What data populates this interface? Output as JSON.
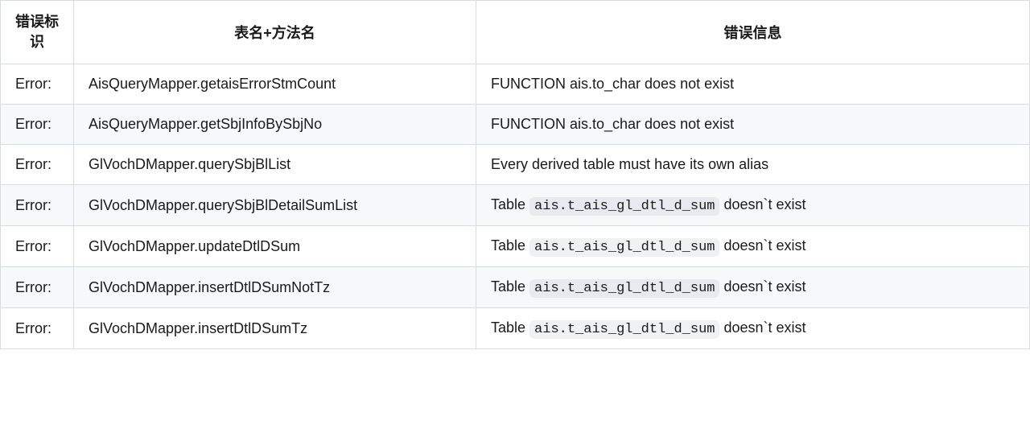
{
  "headers": {
    "flag": "错误标识",
    "method": "表名+方法名",
    "message": "错误信息"
  },
  "rows": [
    {
      "flag": "Error:",
      "method": "AisQueryMapper.getaisErrorStmCount",
      "message_prefix": "FUNCTION ais.to_char does not exist",
      "code": "",
      "message_suffix": ""
    },
    {
      "flag": "Error:",
      "method": "AisQueryMapper.getSbjInfoBySbjNo",
      "message_prefix": "FUNCTION ais.to_char does not exist",
      "code": "",
      "message_suffix": ""
    },
    {
      "flag": "Error:",
      "method": "GlVochDMapper.querySbjBlList",
      "message_prefix": "Every derived table must have its own alias",
      "code": "",
      "message_suffix": ""
    },
    {
      "flag": "Error:",
      "method": "GlVochDMapper.querySbjBlDetailSumList",
      "message_prefix": "Table ",
      "code": "ais.t_ais_gl_dtl_d_sum",
      "message_suffix": " doesn`t exist"
    },
    {
      "flag": "Error:",
      "method": "GlVochDMapper.updateDtlDSum",
      "message_prefix": "Table ",
      "code": "ais.t_ais_gl_dtl_d_sum",
      "message_suffix": " doesn`t exist"
    },
    {
      "flag": "Error:",
      "method": "GlVochDMapper.insertDtlDSumNotTz",
      "message_prefix": "Table ",
      "code": "ais.t_ais_gl_dtl_d_sum",
      "message_suffix": " doesn`t exist"
    },
    {
      "flag": "Error:",
      "method": "GlVochDMapper.insertDtlDSumTz",
      "message_prefix": "Table ",
      "code": "ais.t_ais_gl_dtl_d_sum",
      "message_suffix": " doesn`t exist"
    }
  ]
}
